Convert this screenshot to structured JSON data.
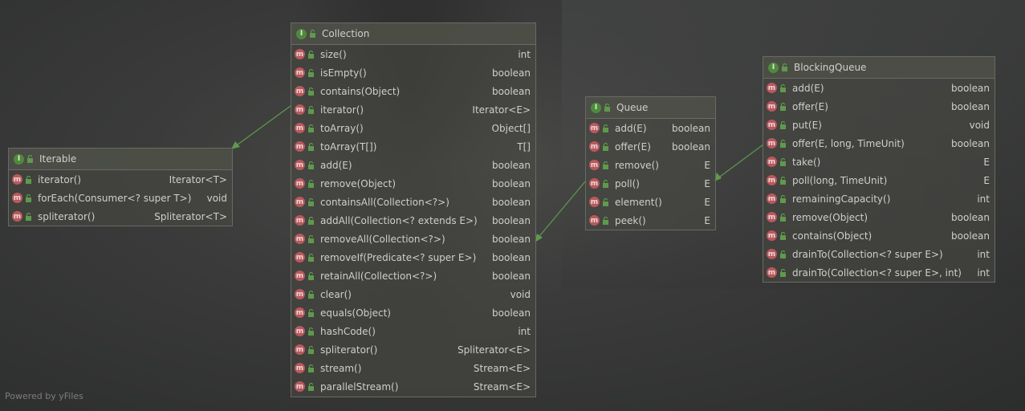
{
  "diagram": {
    "footer": "Powered by yFiles",
    "classes": {
      "iterable": {
        "name": "Iterable",
        "methods": [
          {
            "name": "iterator()",
            "ret": "Iterator<T>"
          },
          {
            "name": "forEach(Consumer<? super T>)",
            "ret": "void"
          },
          {
            "name": "spliterator()",
            "ret": "Spliterator<T>"
          }
        ]
      },
      "collection": {
        "name": "Collection",
        "methods": [
          {
            "name": "size()",
            "ret": "int"
          },
          {
            "name": "isEmpty()",
            "ret": "boolean"
          },
          {
            "name": "contains(Object)",
            "ret": "boolean"
          },
          {
            "name": "iterator()",
            "ret": "Iterator<E>"
          },
          {
            "name": "toArray()",
            "ret": "Object[]"
          },
          {
            "name": "toArray(T[])",
            "ret": "T[]"
          },
          {
            "name": "add(E)",
            "ret": "boolean"
          },
          {
            "name": "remove(Object)",
            "ret": "boolean"
          },
          {
            "name": "containsAll(Collection<?>)",
            "ret": "boolean"
          },
          {
            "name": "addAll(Collection<? extends E>)",
            "ret": "boolean"
          },
          {
            "name": "removeAll(Collection<?>)",
            "ret": "boolean"
          },
          {
            "name": "removeIf(Predicate<? super E>)",
            "ret": "boolean"
          },
          {
            "name": "retainAll(Collection<?>)",
            "ret": "boolean"
          },
          {
            "name": "clear()",
            "ret": "void"
          },
          {
            "name": "equals(Object)",
            "ret": "boolean"
          },
          {
            "name": "hashCode()",
            "ret": "int"
          },
          {
            "name": "spliterator()",
            "ret": "Spliterator<E>"
          },
          {
            "name": "stream()",
            "ret": "Stream<E>"
          },
          {
            "name": "parallelStream()",
            "ret": "Stream<E>"
          }
        ]
      },
      "queue": {
        "name": "Queue",
        "methods": [
          {
            "name": "add(E)",
            "ret": "boolean"
          },
          {
            "name": "offer(E)",
            "ret": "boolean"
          },
          {
            "name": "remove()",
            "ret": "E"
          },
          {
            "name": "poll()",
            "ret": "E"
          },
          {
            "name": "element()",
            "ret": "E"
          },
          {
            "name": "peek()",
            "ret": "E"
          }
        ]
      },
      "blockingqueue": {
        "name": "BlockingQueue",
        "methods": [
          {
            "name": "add(E)",
            "ret": "boolean"
          },
          {
            "name": "offer(E)",
            "ret": "boolean"
          },
          {
            "name": "put(E)",
            "ret": "void"
          },
          {
            "name": "offer(E, long, TimeUnit)",
            "ret": "boolean"
          },
          {
            "name": "take()",
            "ret": "E"
          },
          {
            "name": "poll(long, TimeUnit)",
            "ret": "E"
          },
          {
            "name": "remainingCapacity()",
            "ret": "int"
          },
          {
            "name": "remove(Object)",
            "ret": "boolean"
          },
          {
            "name": "contains(Object)",
            "ret": "boolean"
          },
          {
            "name": "drainTo(Collection<? super E>)",
            "ret": "int"
          },
          {
            "name": "drainTo(Collection<? super E>, int)",
            "ret": "int"
          }
        ]
      }
    },
    "icons": {
      "interface": "interface-icon",
      "method": "method-icon",
      "visibility": "public-lock-icon"
    },
    "colors": {
      "arrow": "#5e9a4c",
      "interface_icon": "#4f8a3c",
      "method_icon": "#b8595d"
    }
  }
}
